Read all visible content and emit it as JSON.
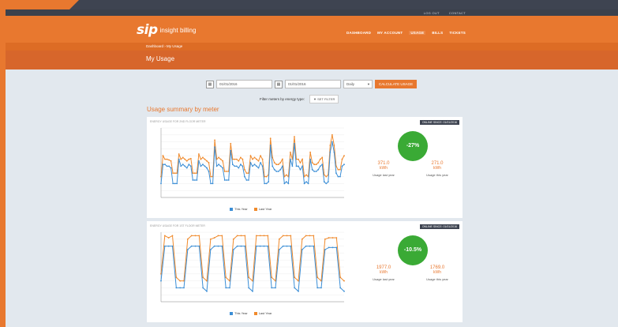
{
  "header": {
    "top_links": [
      "LOG OUT",
      "CONTACT"
    ],
    "logo_mark": "sip",
    "logo_text": "insight billing",
    "nav": [
      "DASHBOARD",
      "MY ACCOUNT",
      "USAGE",
      "BILLS",
      "TICKETS"
    ],
    "nav_active": "USAGE",
    "breadcrumb": "Dashboard › My Usage",
    "page_title": "My Usage"
  },
  "filters": {
    "start_date": "01/01/2016",
    "end_date": "01/01/2016",
    "interval": "Daily",
    "calculate_label": "CALCULATE USAGE",
    "filter_label": "Filter meters by energy type:",
    "filter_button": "SET FILTER"
  },
  "section_title": "Usage summary by meter",
  "colors": {
    "accent": "#e8782f",
    "this_year": "#3b8ed6",
    "last_year": "#f08a2c",
    "savings": "#3aaa35"
  },
  "cards": [
    {
      "caption": "ENERGY USAGE FOR 2ND FLOOR METER",
      "tag": "ONLINE SINCE: 01/01/2016",
      "change": "-27%",
      "last_value": "371.0",
      "last_unit": "kWh",
      "last_label": "Usage last year",
      "this_value": "271.0",
      "this_unit": "kWh",
      "this_label": "Usage this year",
      "legend": [
        "This Year",
        "Last Year"
      ]
    },
    {
      "caption": "ENERGY USAGE FOR 1ST FLOOR METER",
      "tag": "ONLINE SINCE: 01/01/2016",
      "change": "-10.5%",
      "last_value": "1977.0",
      "last_unit": "kWh",
      "last_label": "Usage last year",
      "this_value": "1769.0",
      "this_unit": "kWh",
      "this_label": "Usage this year",
      "legend": [
        "This Year",
        "Last Year"
      ]
    }
  ],
  "chart_data": [
    {
      "type": "line",
      "x": [
        1,
        2,
        3,
        4,
        5,
        6,
        7,
        8,
        9,
        10,
        11,
        12,
        13,
        14,
        15,
        16,
        17,
        18,
        19,
        20,
        21,
        22,
        23,
        24,
        25,
        26,
        27,
        28,
        29,
        30,
        31,
        32,
        33,
        34,
        35,
        36,
        37,
        38,
        39,
        40,
        41,
        42,
        43,
        44,
        45,
        46,
        47,
        48,
        49,
        50,
        51,
        52,
        53,
        54,
        55,
        56,
        57,
        58,
        59,
        60,
        61,
        62,
        63,
        64,
        65,
        66,
        67,
        68,
        69,
        70,
        71,
        72,
        73,
        74,
        75,
        76,
        77,
        78,
        79,
        80,
        81,
        82,
        83,
        84,
        85,
        86,
        87,
        88,
        89,
        90,
        91,
        92,
        93
      ],
      "ylim": [
        0,
        200
      ],
      "series": [
        {
          "name": "This Year",
          "values": [
            40,
            95,
            95,
            90,
            90,
            85,
            40,
            40,
            40,
            110,
            90,
            95,
            90,
            85,
            95,
            90,
            50,
            50,
            50,
            105,
            90,
            95,
            90,
            85,
            75,
            40,
            40,
            145,
            90,
            95,
            90,
            85,
            50,
            50,
            50,
            135,
            95,
            90,
            90,
            85,
            95,
            90,
            60,
            50,
            50,
            100,
            90,
            95,
            90,
            85,
            100,
            90,
            40,
            40,
            45,
            150,
            90,
            80,
            75,
            75,
            80,
            90,
            40,
            45,
            40,
            110,
            90,
            155,
            90,
            90,
            80,
            90,
            40,
            45,
            40,
            110,
            80,
            75,
            75,
            80,
            90,
            95,
            45,
            40,
            45,
            130,
            160,
            130,
            70,
            60,
            60,
            90,
            95
          ],
          "x_note": ""
        },
        {
          "name": "Last Year",
          "values": [
            60,
            120,
            110,
            110,
            108,
            105,
            70,
            70,
            70,
            125,
            110,
            115,
            110,
            105,
            110,
            112,
            70,
            70,
            70,
            125,
            110,
            115,
            110,
            105,
            100,
            60,
            60,
            165,
            110,
            115,
            110,
            105,
            75,
            75,
            75,
            155,
            110,
            110,
            110,
            105,
            115,
            110,
            80,
            70,
            70,
            120,
            110,
            115,
            110,
            105,
            120,
            110,
            60,
            60,
            65,
            170,
            115,
            100,
            95,
            95,
            100,
            110,
            60,
            65,
            60,
            130,
            110,
            175,
            110,
            110,
            100,
            110,
            60,
            65,
            60,
            130,
            100,
            95,
            95,
            100,
            110,
            115,
            65,
            60,
            65,
            150,
            180,
            150,
            90,
            80,
            80,
            110,
            120
          ]
        }
      ]
    },
    {
      "type": "line",
      "ylim": [
        0,
        100
      ],
      "series": [
        {
          "name": "This Year",
          "values": [
            30,
            80,
            80,
            80,
            20,
            20,
            20,
            75,
            80,
            80,
            80,
            20,
            15,
            75,
            80,
            80,
            80,
            20,
            20,
            75,
            80,
            80,
            80,
            20,
            15,
            80,
            80,
            80,
            80,
            20,
            20,
            75,
            80,
            80,
            80,
            20,
            15,
            75,
            80,
            80,
            80,
            20,
            20,
            75,
            78,
            78,
            78,
            20,
            15
          ]
        },
        {
          "name": "Last Year",
          "values": [
            40,
            95,
            92,
            95,
            35,
            30,
            30,
            90,
            95,
            95,
            95,
            35,
            30,
            90,
            92,
            95,
            95,
            35,
            30,
            90,
            95,
            95,
            95,
            35,
            30,
            95,
            95,
            95,
            95,
            35,
            30,
            90,
            95,
            95,
            95,
            35,
            30,
            90,
            95,
            95,
            95,
            35,
            30,
            90,
            92,
            92,
            92,
            35,
            30
          ]
        }
      ]
    }
  ]
}
